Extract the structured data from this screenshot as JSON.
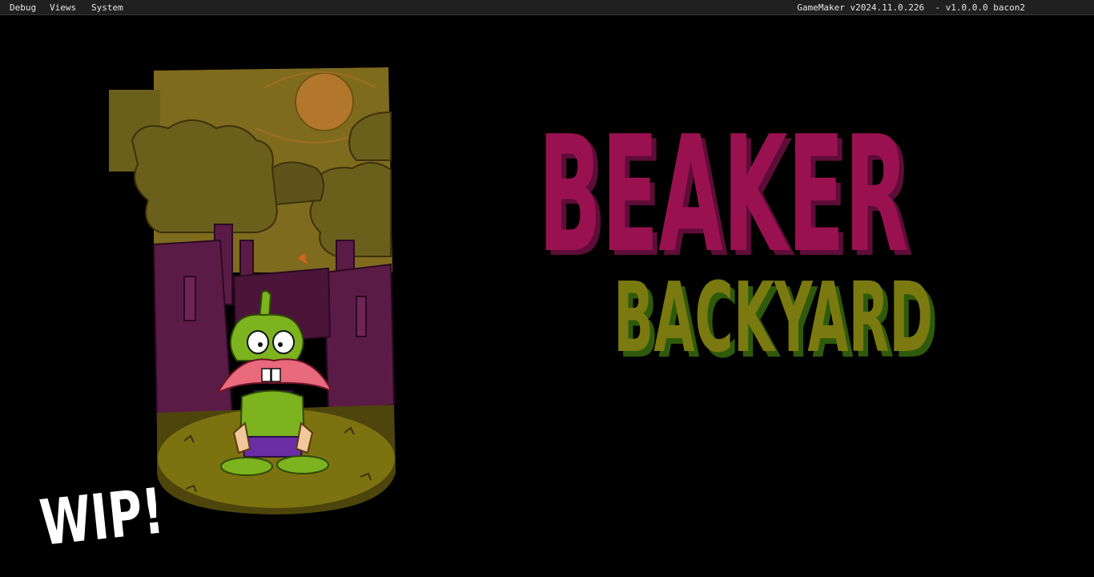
{
  "menu": {
    "debug": "Debug",
    "views": "Views",
    "system": "System",
    "version": "GameMaker v2024.11.0.226  - v1.0.0.0 bacon2"
  },
  "title": {
    "line1": "BEAKER",
    "line2": "BACKYARD",
    "badge": "WIP!"
  },
  "colors": {
    "menubar_bg": "#202020",
    "title_primary": "#9a1150",
    "title_secondary": "#7a7a10",
    "sky": "#7f6b1e",
    "sun": "#b3772c",
    "trees": "#6b5f1c",
    "walls": "#5b1b47",
    "grass": "#7d7210",
    "character_body": "#7db31e",
    "character_mouth": "#e86a7c",
    "character_pants": "#6b2da3"
  },
  "icons": {
    "character": "beaker-character",
    "sun": "sun-icon"
  }
}
